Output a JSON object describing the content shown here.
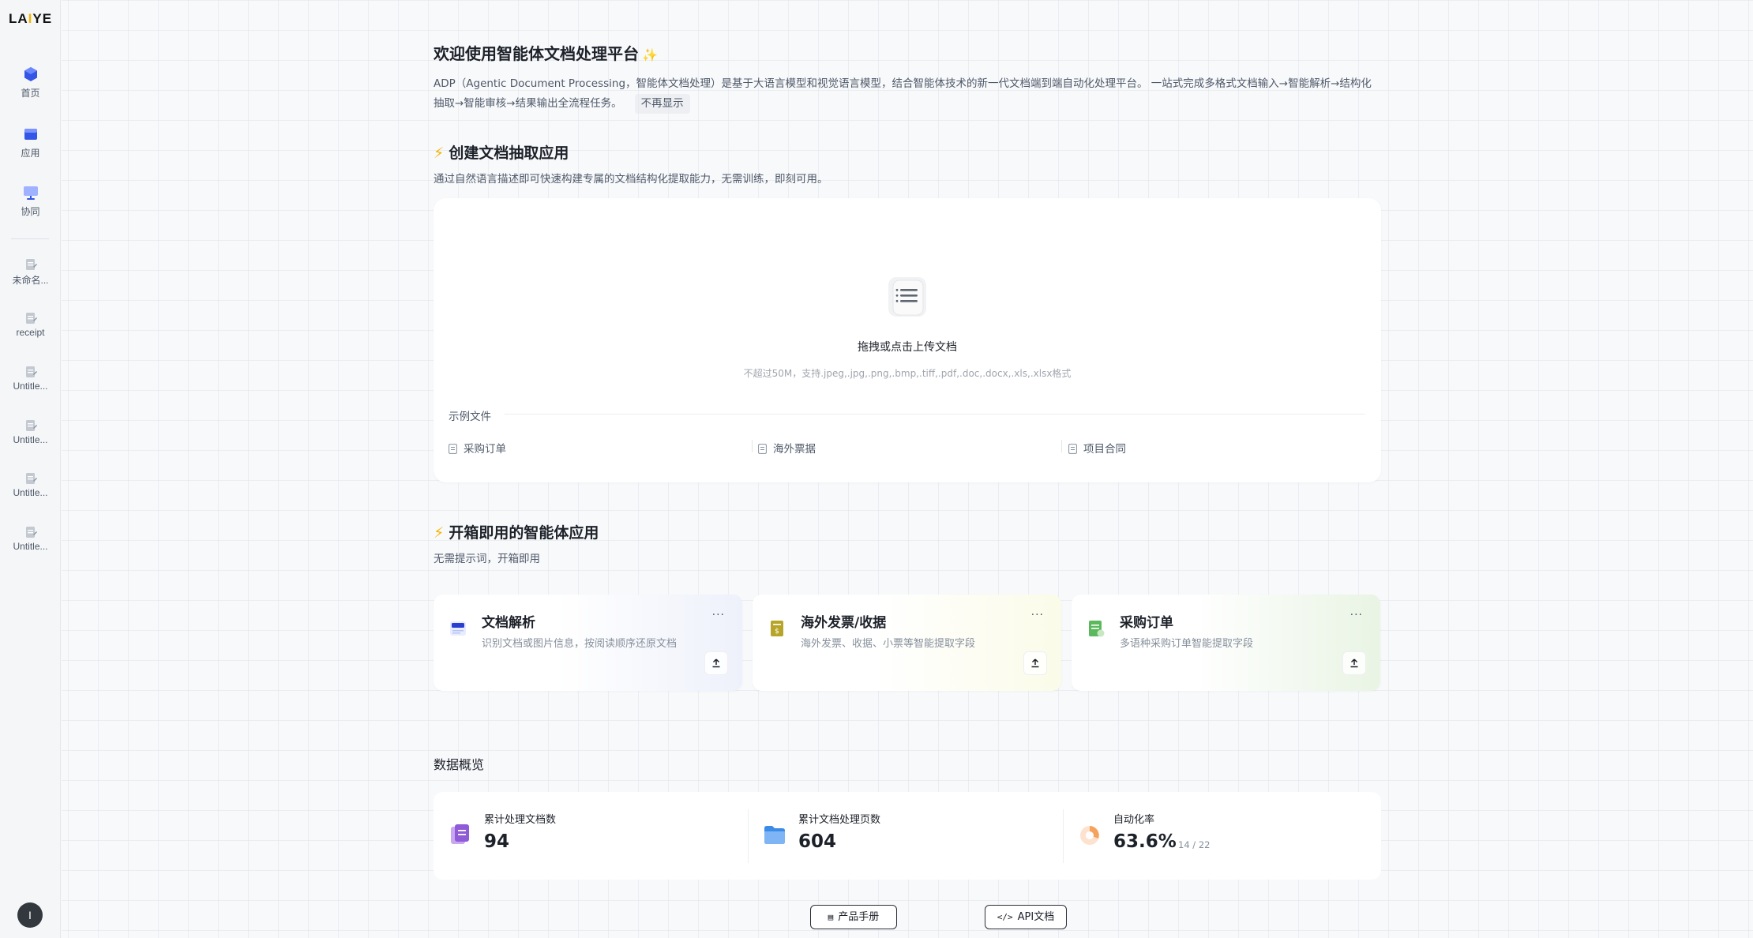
{
  "sidebar": {
    "logo": "LAIYE",
    "nav": [
      {
        "label": "首页",
        "icon": "home-cube-icon"
      },
      {
        "label": "应用",
        "icon": "apps-icon"
      },
      {
        "label": "协同",
        "icon": "collab-monitor-icon"
      }
    ],
    "docs": [
      {
        "label": "未命名...",
        "icon": "document-icon"
      },
      {
        "label": "receipt",
        "icon": "document-icon"
      },
      {
        "label": "Untitle...",
        "icon": "document-icon"
      },
      {
        "label": "Untitle...",
        "icon": "document-icon"
      },
      {
        "label": "Untitle...",
        "icon": "document-icon"
      },
      {
        "label": "Untitle...",
        "icon": "document-icon"
      }
    ],
    "avatar_letter": "I"
  },
  "header": {
    "title": "欢迎使用智能体文档处理平台",
    "intro": "ADP（Agentic Document Processing，智能体文档处理）是基于大语言模型和视觉语言模型，结合智能体技术的新一代文档端到端自动化处理平台。 一站式完成多格式文档输入→智能解析→结构化抽取→智能审核→结果输出全流程任务。",
    "dismiss_label": "不再显示"
  },
  "create_section": {
    "title": "创建文档抽取应用",
    "subtitle": "通过自然语言描述即可快速构建专属的文档结构化提取能力，无需训练，即刻可用。",
    "upload_title": "拖拽或点击上传文档",
    "upload_hint": "不超过50M，支持.jpeg,.jpg,.png,.bmp,.tiff,.pdf,.doc,.docx,.xls,.xlsx格式",
    "samples_label": "示例文件",
    "samples": [
      "采购订单",
      "海外票据",
      "项目合同"
    ]
  },
  "apps_section": {
    "title": "开箱即用的智能体应用",
    "subtitle": "无需提示词，开箱即用",
    "more_label": "···",
    "apps": [
      {
        "title": "文档解析",
        "desc": "识别文档或图片信息，按阅读顺序还原文档",
        "icon": "document-parse-icon",
        "color": "#3b4fd8"
      },
      {
        "title": "海外发票/收据",
        "desc": "海外发票、收据、小票等智能提取字段",
        "icon": "invoice-icon",
        "color": "#b7a52a"
      },
      {
        "title": "采购订单",
        "desc": "多语种采购订单智能提取字段",
        "icon": "purchase-order-icon",
        "color": "#4caf50"
      }
    ]
  },
  "stats": {
    "title": "数据概览",
    "items": [
      {
        "label": "累计处理文档数",
        "value": "94",
        "sub": "",
        "icon": "documents-stack-icon"
      },
      {
        "label": "累计文档处理页数",
        "value": "604",
        "sub": "",
        "icon": "folder-icon"
      },
      {
        "label": "自动化率",
        "value": "63.6%",
        "sub": "14 / 22",
        "icon": "automation-rate-icon"
      }
    ]
  },
  "footer": {
    "manual_label": "产品手册",
    "api_label": "API文档"
  },
  "colors": {
    "accent": "#f5b301",
    "text": "#1d2129",
    "muted": "#86909c"
  }
}
